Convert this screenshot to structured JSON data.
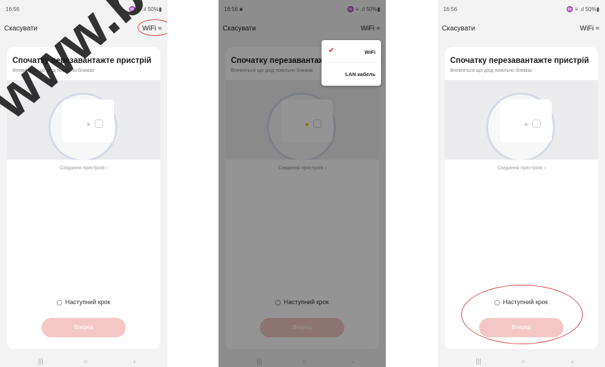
{
  "screens": [
    {
      "status_time": "16:56",
      "status_icons": "♒ ≡ .ıl 50%▮",
      "cancel_label": "Скасувати",
      "network_label": "WiFi ≈",
      "title": "Спочатку перезавантажте пристрій",
      "subtitle": "Впевніться що діод повільно блимає",
      "reset_link": "Скидання пристроїв ›",
      "next_step_label": "Наступний крок",
      "next_button_label": "Вперед"
    },
    {
      "status_time": "16:56 ■",
      "status_icons": "♒ ≡ .ıl 50%▮",
      "cancel_label": "Скасувати",
      "network_label": "WiFi ≈",
      "title": "Спочатку перезавантажте пристрій",
      "subtitle": "Впевніться що діод повільно блимає",
      "reset_link": "Скидання пристроїв ›",
      "next_step_label": "Наступний крок",
      "next_button_label": "Вперед",
      "dropdown": {
        "items": [
          "WiFi",
          "LAN кабель"
        ],
        "selected": "WiFi",
        "check_icon": "✔"
      }
    },
    {
      "status_time": "16:56",
      "status_icons": "♒ ≡ .ıl 50%▮",
      "cancel_label": "Скасувати",
      "network_label": "WiFi ≈",
      "title": "Спочатку перезавантажте пристрій",
      "subtitle": "Впевніться що діод повільно блимає",
      "reset_link": "Скидання пристроїв ›",
      "next_step_label": "Наступний крок",
      "next_button_label": "Вперед"
    }
  ],
  "nav_glyphs": {
    "recent": "|||",
    "home": "○",
    "back": "‹"
  },
  "watermark_text": "www.bez",
  "colors": {
    "accent": "#f5c6c6",
    "highlight_ring": "#d94a4a",
    "check": "#e8463f"
  }
}
